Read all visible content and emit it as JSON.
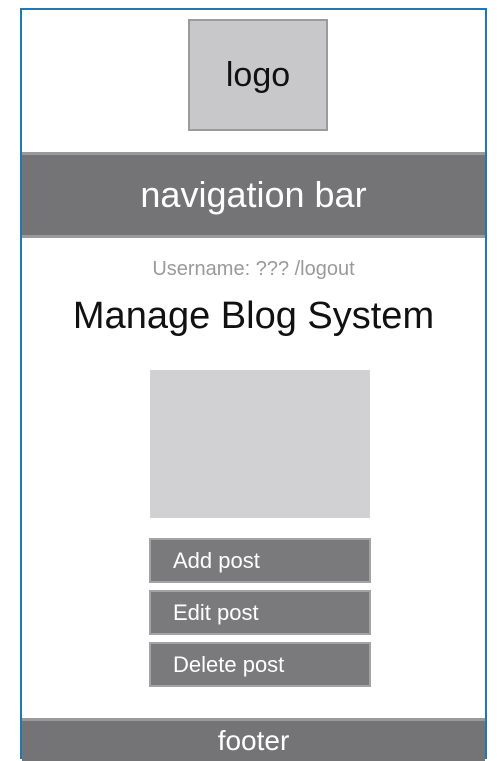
{
  "header": {
    "logo_text": "logo"
  },
  "nav": {
    "label": "navigation bar"
  },
  "user": {
    "status": "Username: ??? /logout"
  },
  "main": {
    "title": "Manage Blog System",
    "actions": [
      {
        "label": "Add post"
      },
      {
        "label": "Edit post"
      },
      {
        "label": "Delete post"
      }
    ]
  },
  "footer": {
    "label": "footer"
  },
  "colors": {
    "frame_border": "#1f78b4",
    "bar_fill": "#747476",
    "placeholder_fill": "#c8c8ca",
    "button_fill": "#7a7a7c"
  }
}
